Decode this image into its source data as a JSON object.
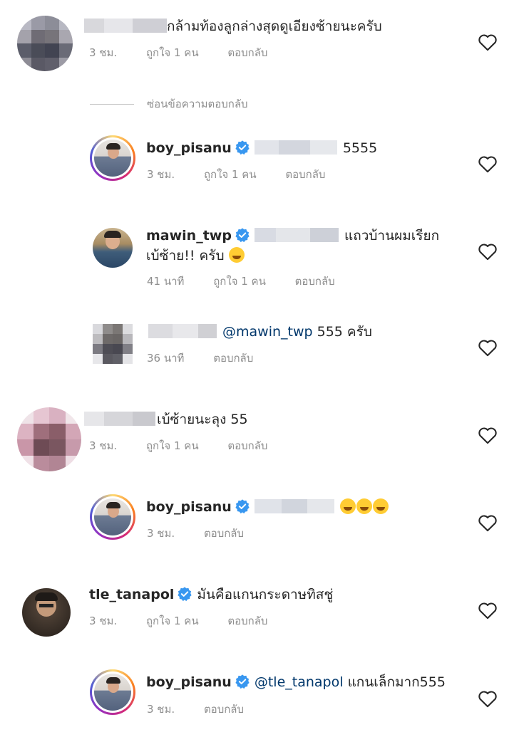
{
  "hide_replies_label": "ซ่อนข้อความตอบกลับ",
  "colors": {
    "mention": "#00376b",
    "meta": "#8e8e8e",
    "verified": "#3897f0"
  },
  "comments": [
    {
      "username": "",
      "text": "กล้ามท้องลูกล่างสุดดูเอียงซ้ายนะครับ",
      "time": "3 ชม.",
      "likes": "ถูกใจ 1 คน",
      "reply": "ตอบกลับ"
    },
    {
      "username": "boy_pisanu",
      "verified": true,
      "text": "5555",
      "time": "3 ชม.",
      "likes": "ถูกใจ 1 คน",
      "reply": "ตอบกลับ"
    },
    {
      "username": "mawin_twp",
      "verified": true,
      "text_line1": "แถวบ้านผมเรียก",
      "text_line2": "เบ้ซ้าย!! ครับ",
      "emoji": "smirk-emoji",
      "time": "41 นาที",
      "likes": "ถูกใจ 1 คน",
      "reply": "ตอบกลับ"
    },
    {
      "username": "",
      "mention": "@mawin_twp",
      "text": "555 ครับ",
      "time": "36 นาที",
      "reply": "ตอบกลับ"
    },
    {
      "username": "",
      "text": "เบ้ซ้ายนะลุง 55",
      "time": "3 ชม.",
      "likes": "ถูกใจ 1 คน",
      "reply": "ตอบกลับ"
    },
    {
      "username": "boy_pisanu",
      "verified": true,
      "emoji": "grinning-sweat-emoji x3",
      "time": "3 ชม.",
      "reply": "ตอบกลับ"
    },
    {
      "username": "tle_tanapol",
      "verified": true,
      "text": "มันคือแกนกระดาษทิสชู่",
      "time": "3 ชม.",
      "likes": "ถูกใจ 1 คน",
      "reply": "ตอบกลับ"
    },
    {
      "username": "boy_pisanu",
      "verified": true,
      "mention": "@tle_tanapol",
      "text": "แกนเล็กมาก555",
      "time": "3 ชม.",
      "reply": "ตอบกลับ"
    }
  ]
}
